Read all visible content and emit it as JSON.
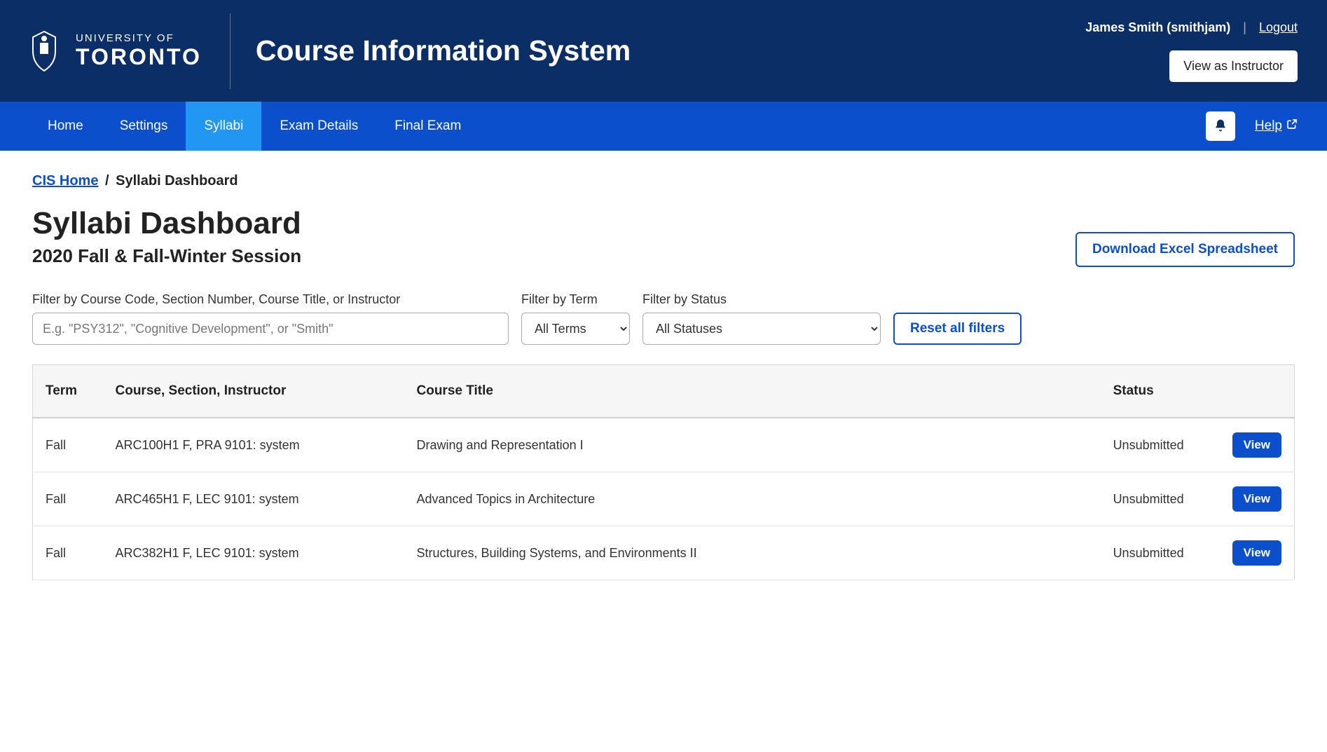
{
  "brand": {
    "line1": "UNIVERSITY OF",
    "line2": "TORONTO"
  },
  "header": {
    "app_title": "Course Information System",
    "user_display": "James Smith (smithjam)",
    "logout": "Logout",
    "view_as": "View as Instructor"
  },
  "nav": {
    "items": [
      {
        "label": "Home",
        "active": false
      },
      {
        "label": "Settings",
        "active": false
      },
      {
        "label": "Syllabi",
        "active": true
      },
      {
        "label": "Exam Details",
        "active": false
      },
      {
        "label": "Final Exam",
        "active": false
      }
    ],
    "help": "Help"
  },
  "breadcrumb": {
    "home_label": "CIS Home",
    "current": "Syllabi Dashboard"
  },
  "page": {
    "title": "Syllabi Dashboard",
    "subtitle": "2020 Fall & Fall-Winter Session",
    "download_label": "Download Excel Spreadsheet"
  },
  "filters": {
    "text_label": "Filter by Course Code, Section Number, Course Title, or Instructor",
    "text_placeholder": "E.g. \"PSY312\", \"Cognitive Development\", or \"Smith\"",
    "term_label": "Filter by Term",
    "term_selected": "All Terms",
    "status_label": "Filter by Status",
    "status_selected": "All Statuses",
    "reset_label": "Reset all filters"
  },
  "table": {
    "headers": {
      "term": "Term",
      "course": "Course, Section, Instructor",
      "title": "Course Title",
      "status": "Status"
    },
    "view_label": "View",
    "rows": [
      {
        "term": "Fall",
        "course": "ARC100H1 F, PRA 9101: system",
        "title": "Drawing and Representation I",
        "status": "Unsubmitted"
      },
      {
        "term": "Fall",
        "course": "ARC465H1 F, LEC 9101: system",
        "title": "Advanced Topics in Architecture",
        "status": "Unsubmitted"
      },
      {
        "term": "Fall",
        "course": "ARC382H1 F, LEC 9101: system",
        "title": "Structures, Building Systems, and Environments II",
        "status": "Unsubmitted"
      }
    ]
  }
}
